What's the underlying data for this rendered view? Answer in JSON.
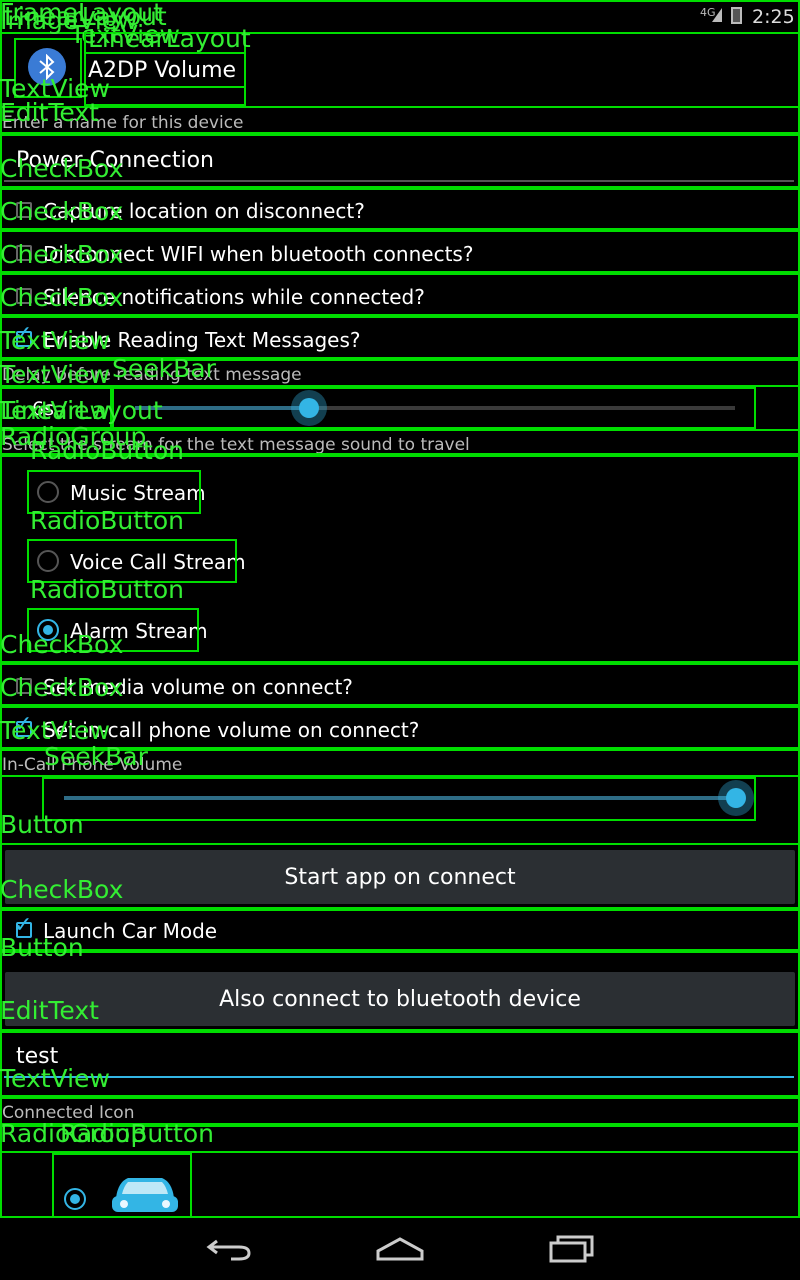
{
  "status_bar": {
    "signal": "4G",
    "time": "2:25"
  },
  "device": {
    "name": "A2DP Volume"
  },
  "prompt": "Enter a name for this device",
  "device_name_value": "Power Connection",
  "checks": [
    {
      "label": "Capture location on disconnect?",
      "checked": false
    },
    {
      "label": "Disconnect WIFI when bluetooth connects?",
      "checked": false
    },
    {
      "label": "Silence notifications while connected?",
      "checked": false
    },
    {
      "label": "Enable Reading Text Messages?",
      "checked": true
    }
  ],
  "delay_label": "Delay before reading text message",
  "delay_value": "6s",
  "delay_slider_fraction": 0.29,
  "stream_label": "Select the stream for the text message sound to travel",
  "radios": [
    {
      "label": "Music Stream",
      "checked": false
    },
    {
      "label": "Voice Call Stream",
      "checked": false
    },
    {
      "label": "Alarm Stream",
      "checked": true
    }
  ],
  "radio_vol": {
    "label": "Set media volume on connect?",
    "checked": false
  },
  "phone_vol": {
    "label": "Set in-call phone volume on connect?",
    "checked": true
  },
  "incall_label": "In-Call Phone Volume",
  "incall_slider_fraction": 1.0,
  "start_app_button": "Start app on connect",
  "car_mode": {
    "label": "Launch Car Mode",
    "checked": true
  },
  "also_connect_button": "Also connect to bluetooth device",
  "also_connect_value": "test",
  "icon_label": "Connected Icon",
  "nav": {
    "back": "back-icon",
    "home": "home-icon",
    "recents": "recents-icon"
  },
  "colors": {
    "accent": "#33b5e5",
    "overlay": "#00dd00"
  },
  "overlay_labels": {
    "frame_layout": "FrameLayout",
    "linear_layout": "LinearLayout",
    "image_view": "ImageView",
    "text_view": "TextView",
    "edit_text": "EditText",
    "check_box": "CheckBox",
    "seek_bar": "SeekBar",
    "radio_group": "RadioGroup",
    "radio_button": "RadioButton",
    "button": "Button"
  }
}
